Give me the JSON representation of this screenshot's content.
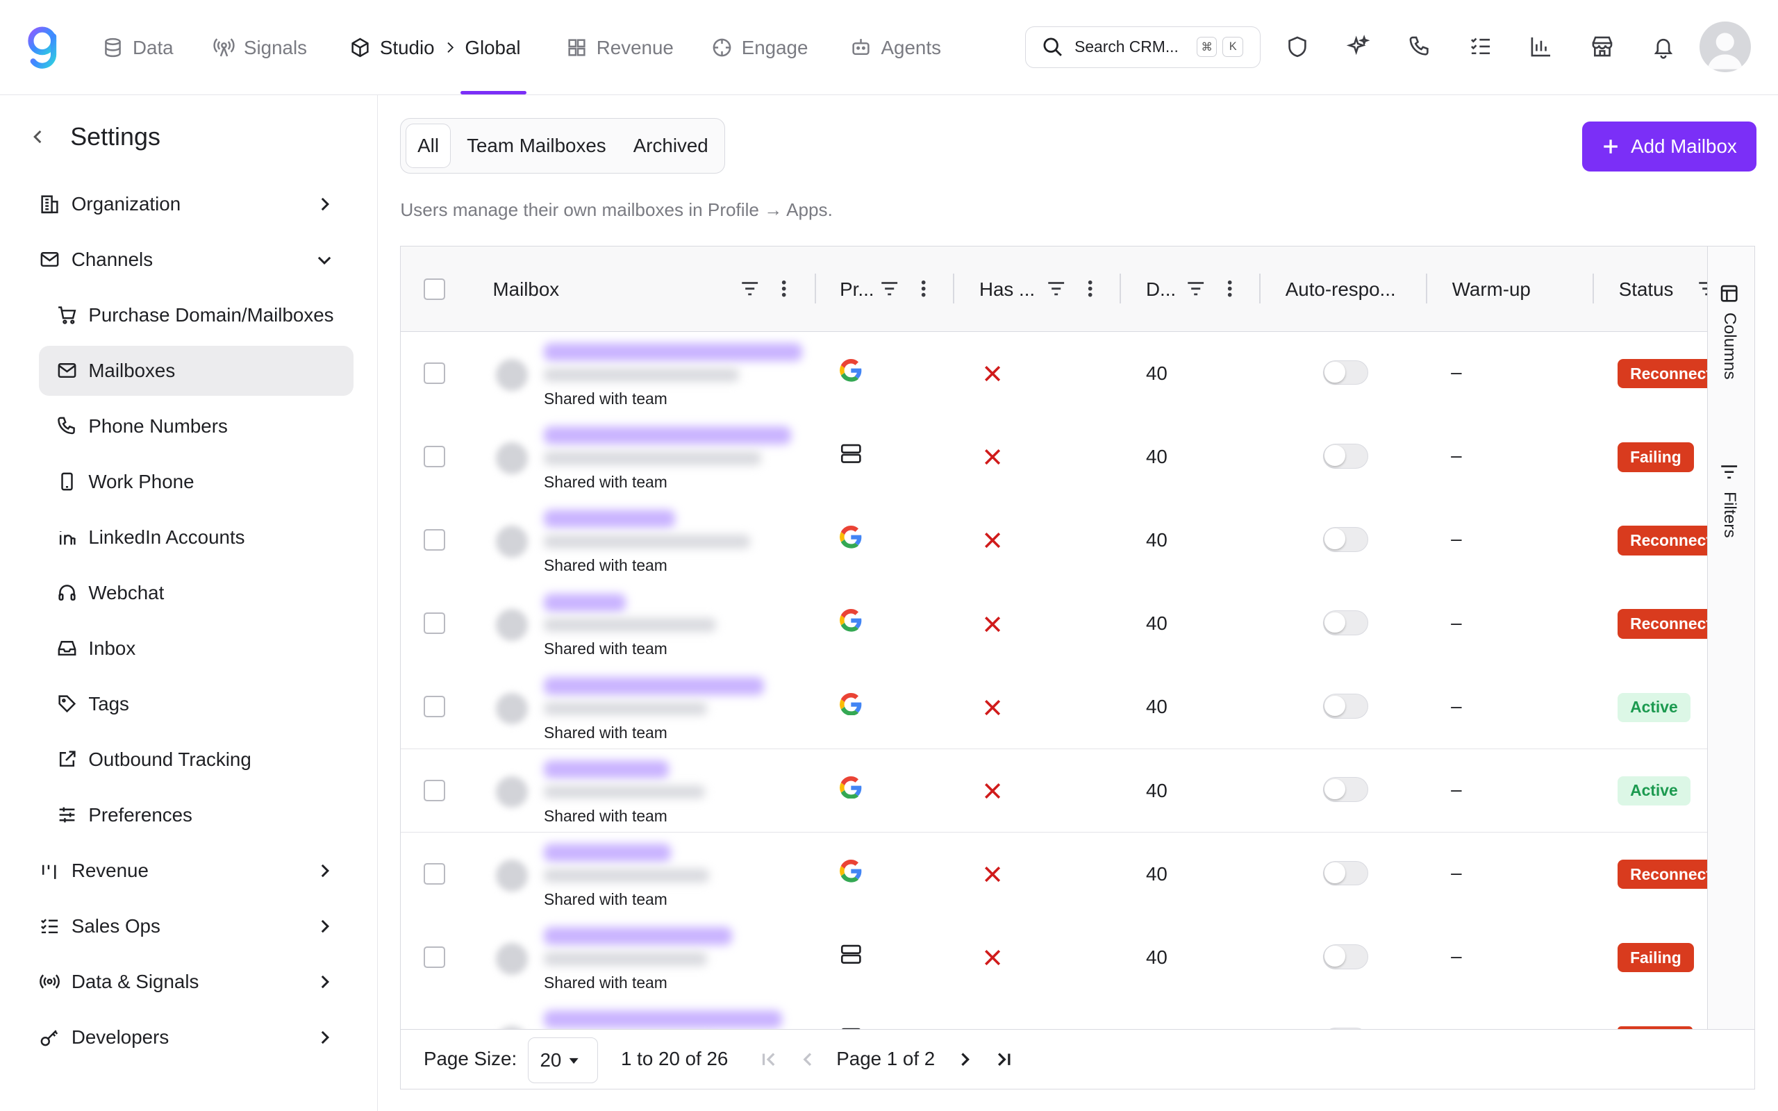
{
  "nav": {
    "items": [
      "Data",
      "Signals",
      "Studio",
      "Global",
      "Revenue",
      "Engage",
      "Agents"
    ],
    "search_placeholder": "Search CRM...",
    "search_kbd": [
      "⌘",
      "K"
    ]
  },
  "sidebar": {
    "title": "Settings",
    "items": [
      {
        "label": "Organization",
        "icon": "building-icon"
      },
      {
        "label": "Channels",
        "icon": "mail-icon"
      },
      {
        "label": "Purchase Domain/Mailboxes",
        "icon": "cart-icon"
      },
      {
        "label": "Mailboxes",
        "icon": "mail-icon"
      },
      {
        "label": "Phone Numbers",
        "icon": "phone-icon"
      },
      {
        "label": "Work Phone",
        "icon": "mobile-icon"
      },
      {
        "label": "LinkedIn Accounts",
        "icon": "linkedin-icon"
      },
      {
        "label": "Webchat",
        "icon": "headset-icon"
      },
      {
        "label": "Inbox",
        "icon": "inbox-icon"
      },
      {
        "label": "Tags",
        "icon": "tag-icon"
      },
      {
        "label": "Outbound Tracking",
        "icon": "external-link-icon"
      },
      {
        "label": "Preferences",
        "icon": "sliders-icon"
      },
      {
        "label": "Revenue",
        "icon": "bars-icon"
      },
      {
        "label": "Sales Ops",
        "icon": "checklist-icon"
      },
      {
        "label": "Data & Signals",
        "icon": "broadcast-icon"
      },
      {
        "label": "Developers",
        "icon": "key-icon"
      }
    ]
  },
  "main": {
    "tabs": [
      "All",
      "Team Mailboxes",
      "Archived"
    ],
    "add_button": "Add Mailbox",
    "hint": "Users manage their own mailboxes in Profile → Apps.",
    "columns": [
      "Mailbox",
      "Pr...",
      "Has ...",
      "D...",
      "Auto-respo...",
      "Warm-up",
      "Status"
    ],
    "side_tabs": [
      "Columns",
      "Filters"
    ],
    "rows": [
      {
        "shared": "Shared with team",
        "provider": "google",
        "value": "40",
        "warmup": "–",
        "status": "Reconnect",
        "status_kind": "err"
      },
      {
        "shared": "Shared with team",
        "provider": "server",
        "value": "40",
        "warmup": "–",
        "status": "Failing",
        "status_kind": "err"
      },
      {
        "shared": "Shared with team",
        "provider": "google",
        "value": "40",
        "warmup": "–",
        "status": "Reconnect",
        "status_kind": "err"
      },
      {
        "shared": "Shared with team",
        "provider": "google",
        "value": "40",
        "warmup": "–",
        "status": "Reconnect",
        "status_kind": "err"
      },
      {
        "shared": "Shared with team",
        "provider": "google",
        "value": "40",
        "warmup": "–",
        "status": "Active",
        "status_kind": "ok"
      },
      {
        "shared": "Shared with team",
        "provider": "google",
        "value": "40",
        "warmup": "–",
        "status": "Active",
        "status_kind": "ok"
      },
      {
        "shared": "Shared with team",
        "provider": "google",
        "value": "40",
        "warmup": "–",
        "status": "Reconnect",
        "status_kind": "err"
      },
      {
        "shared": "Shared with team",
        "provider": "server",
        "value": "40",
        "warmup": "–",
        "status": "Failing",
        "status_kind": "err"
      },
      {
        "shared": "",
        "provider": "server",
        "value": "",
        "warmup": "",
        "status": "",
        "status_kind": "err"
      }
    ],
    "pager": {
      "page_size_label": "Page Size:",
      "page_size": "20",
      "range": "1 to 20 of 26",
      "page": "Page 1 of 2"
    }
  },
  "colors": {
    "accent": "#7b2ff7",
    "error": "#d93b1e",
    "success": "#1c9a50"
  }
}
